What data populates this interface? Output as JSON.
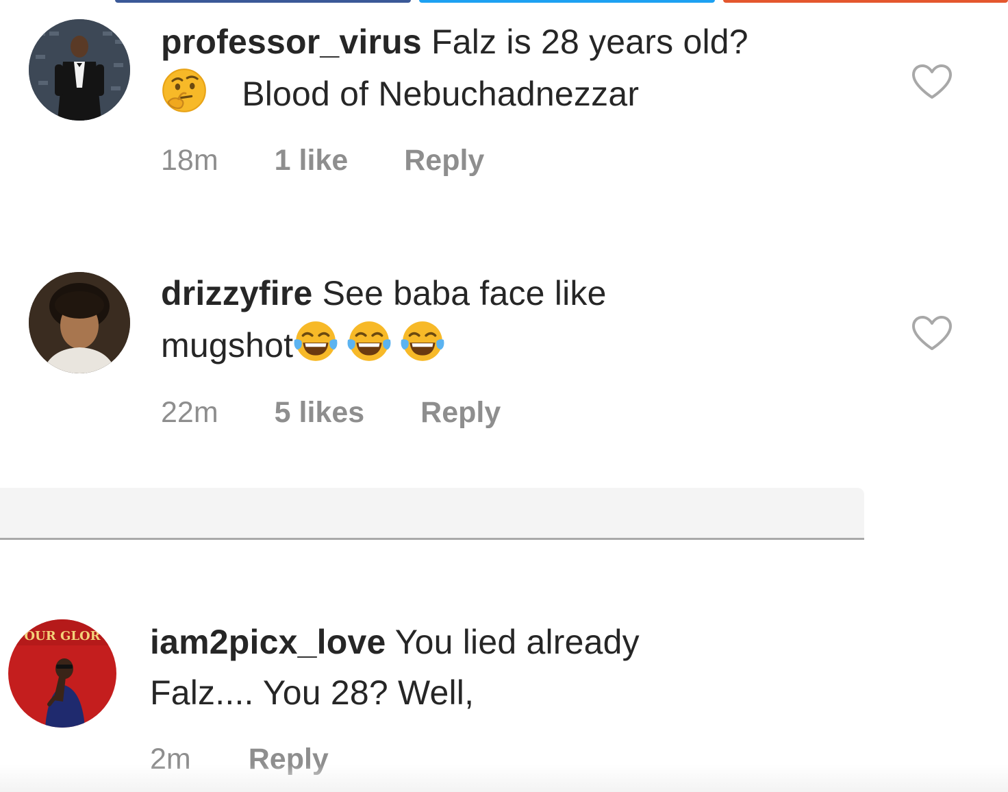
{
  "colors": {
    "top_bar_1": "#3b5998",
    "top_bar_2": "#1da1f2",
    "top_bar_3": "#e4572e",
    "meta_gray": "#8e8e8e",
    "text_dark": "#262626"
  },
  "comments": [
    {
      "username": "professor_virus",
      "line1": "Falz is 28 years old?",
      "emoji": "thinking-face",
      "line2": "Blood of Nebuchadnezzar",
      "time": "18m",
      "likes": "1 like",
      "reply": "Reply",
      "heart_icon": "heart-outline-icon"
    },
    {
      "username": "drizzyfire",
      "line1": "See baba face like",
      "line2": "mugshot",
      "emoji": "face-with-tears-of-joy x3",
      "time": "22m",
      "likes": "5 likes",
      "reply": "Reply",
      "heart_icon": "heart-outline-icon"
    },
    {
      "username": "iam2picx_love",
      "avatar_text": "OUR GLOR",
      "line1": "You lied already",
      "line2": "Falz.... You 28? Well,",
      "time": "2m",
      "reply": "Reply"
    }
  ]
}
